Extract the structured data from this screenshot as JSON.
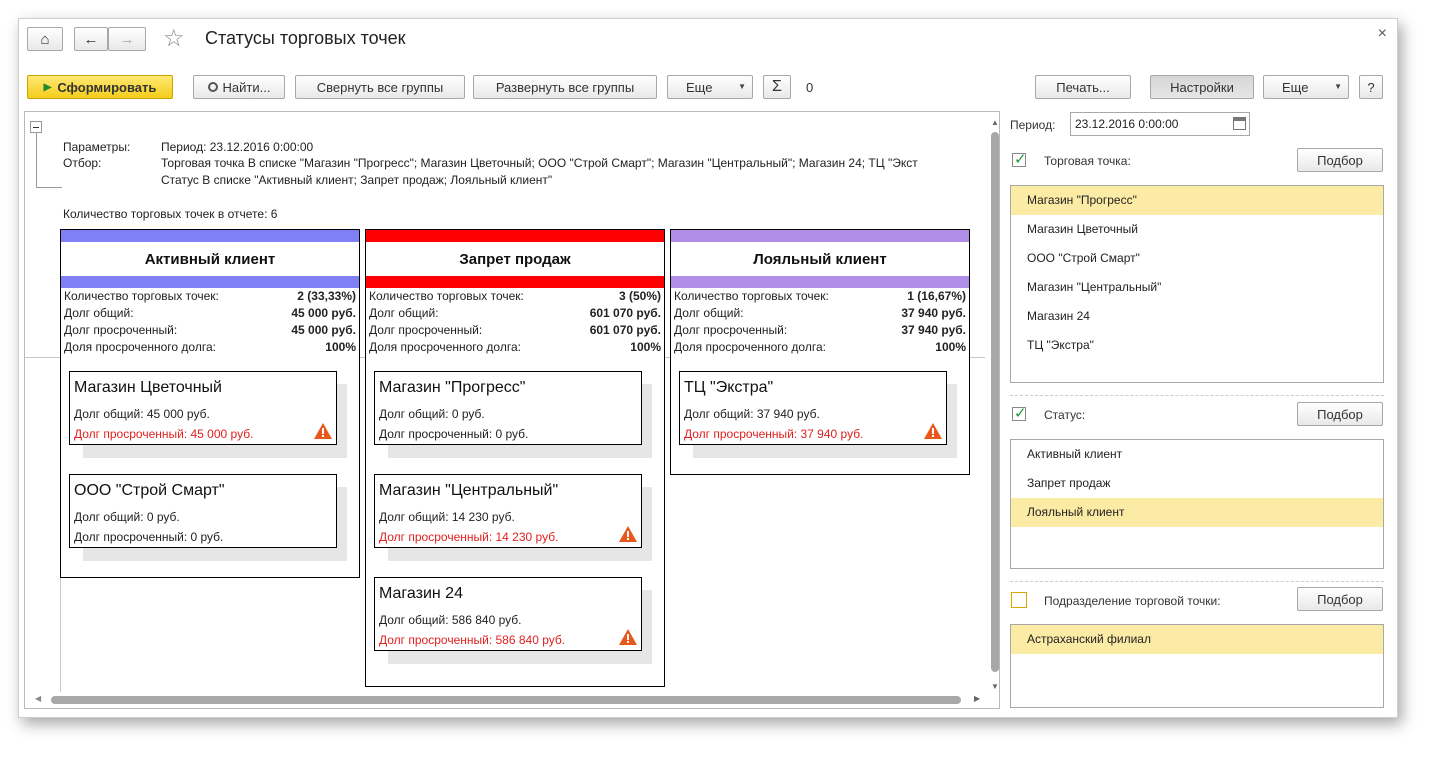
{
  "window": {
    "title": "Статусы торговых точек",
    "close": "×"
  },
  "toolbar": {
    "home": "⌂",
    "back": "←",
    "forward": "→",
    "star": "☆",
    "generate": "Сформировать",
    "find": "Найти...",
    "collapse_all": "Свернуть все группы",
    "expand_all": "Развернуть все группы",
    "more": "Еще",
    "sum": "Σ",
    "sum_value": "0",
    "print": "Печать...",
    "settings": "Настройки",
    "more2": "Еще",
    "help": "?"
  },
  "params": {
    "params_label": "Параметры:",
    "period_text": "Период: 23.12.2016 0:00:00",
    "filter_label": "Отбор:",
    "filter_line1": "Торговая точка В списке \"Магазин \"Прогресс\"; Магазин Цветочный; ООО \"Строй Смарт\"; Магазин \"Центральный\"; Магазин 24; ТЦ \"Экст",
    "filter_line2": "Статус В списке \"Активный клиент; Запрет продаж; Лояльный клиент\"",
    "count_text": "Количество торговых точек в отчете: 6"
  },
  "stat_labels": {
    "count": "Количество торговых точек:",
    "debt_total": "Долг общий:",
    "debt_overdue": "Долг просроченный:",
    "overdue_share": "Доля просроченного долга:"
  },
  "columns": [
    {
      "title": "Активный клиент",
      "color": "#8080f4",
      "count": "2 (33,33%)",
      "debt_total": "45 000 руб.",
      "debt_overdue": "45 000 руб.",
      "share": "100%",
      "cards": [
        {
          "name": "Магазин Цветочный",
          "total": "Долг общий: 45 000 руб.",
          "overdue": "Долг просроченный: 45 000 руб.",
          "warn": true
        },
        {
          "name": "ООО \"Строй Смарт\"",
          "total": "Долг общий: 0 руб.",
          "overdue": "Долг просроченный: 0 руб.",
          "warn": false
        }
      ]
    },
    {
      "title": "Запрет продаж",
      "color": "#ff0000",
      "count": "3 (50%)",
      "debt_total": "601 070 руб.",
      "debt_overdue": "601 070 руб.",
      "share": "100%",
      "cards": [
        {
          "name": "Магазин \"Прогресс\"",
          "total": "Долг общий: 0 руб.",
          "overdue": "Долг просроченный: 0 руб.",
          "warn": false
        },
        {
          "name": "Магазин \"Центральный\"",
          "total": "Долг общий: 14 230 руб.",
          "overdue": "Долг просроченный: 14 230 руб.",
          "warn": true
        },
        {
          "name": "Магазин 24",
          "total": "Долг общий: 586 840 руб.",
          "overdue": "Долг просроченный: 586 840 руб.",
          "warn": true
        }
      ]
    },
    {
      "title": "Лояльный клиент",
      "color": "#b08ee8",
      "count": "1 (16,67%)",
      "debt_total": "37 940 руб.",
      "debt_overdue": "37 940 руб.",
      "share": "100%",
      "cards": [
        {
          "name": "ТЦ \"Экстра\"",
          "total": "Долг общий: 37 940 руб.",
          "overdue": "Долг просроченный: 37 940 руб.",
          "warn": true
        }
      ]
    }
  ],
  "settings_panel": {
    "period_label": "Период:",
    "period_value": "23.12.2016  0:00:00",
    "outlet_label": "Торговая точка:",
    "pick": "Подбор",
    "outlets": [
      "Магазин \"Прогресс\"",
      "Магазин Цветочный",
      "ООО \"Строй Смарт\"",
      "Магазин \"Центральный\"",
      "Магазин 24",
      "ТЦ \"Экстра\""
    ],
    "status_label": "Статус:",
    "statuses": [
      "Активный клиент",
      "Запрет продаж",
      "Лояльный клиент"
    ],
    "division_label": "Подразделение торговой точки:",
    "divisions": [
      "Астраханский филиал"
    ]
  }
}
